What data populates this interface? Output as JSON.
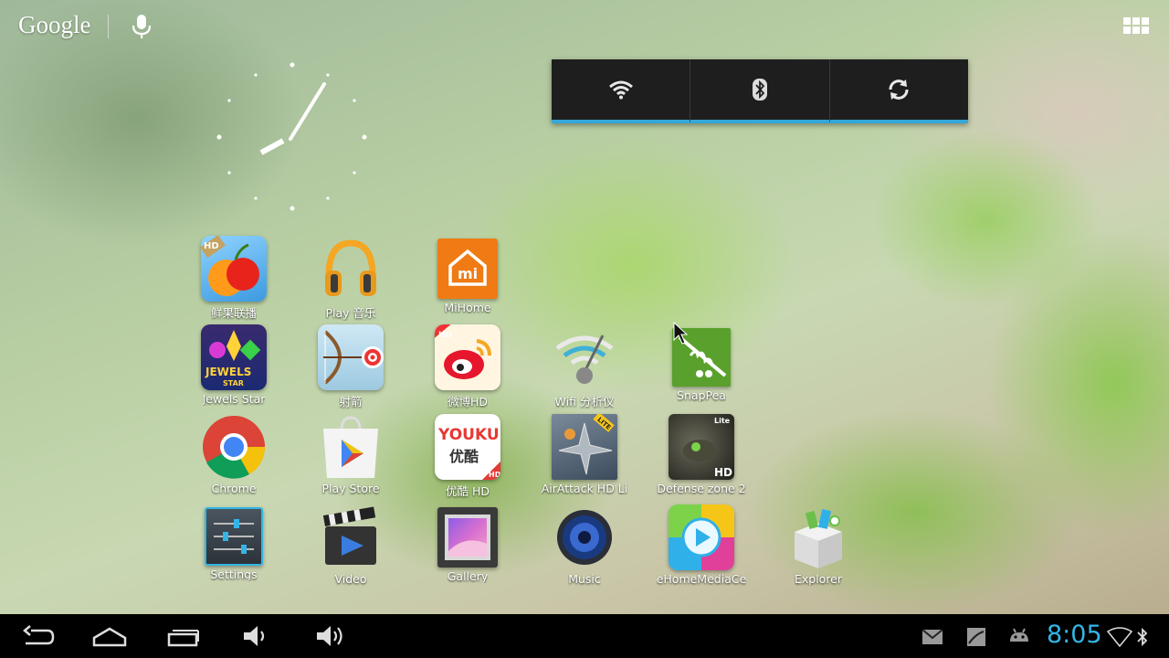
{
  "search_bar": {
    "brand": "Google",
    "voice_icon": "mic-icon"
  },
  "launcher_button_icon": "apps-grid-icon",
  "clock_widget": {
    "type": "analog",
    "time": "8:05"
  },
  "quick_settings": [
    {
      "name": "wifi",
      "icon": "wifi-icon"
    },
    {
      "name": "bluetooth",
      "icon": "bluetooth-icon"
    },
    {
      "name": "sync",
      "icon": "sync-icon"
    }
  ],
  "apps": {
    "xianguo": "鲜果联播",
    "play_music": "Play 音乐",
    "mihome": "MiHome",
    "jewels_star": "Jewels Star",
    "archery": "射箭",
    "weibo": "微博HD",
    "wifi_analyzer": "Wifi 分析仪",
    "snappea": "SnapPea",
    "chrome": "Chrome",
    "play_store": "Play Store",
    "youku": "优酷 HD",
    "airattack": "AirAttack HD Li",
    "defense_zone": "Defense zone 2",
    "settings": "Settings",
    "video": "Video",
    "gallery": "Gallery",
    "music": "Music",
    "ehome": "eHomeMediaCe",
    "explorer": "Explorer"
  },
  "icon_text": {
    "hd": "HD",
    "mi": "mi",
    "jewels": "JEWELS",
    "star": "STAR",
    "youku": "YOUKU",
    "youku_cn": "优酷",
    "lite_badge": "LITE",
    "lite": "Lite"
  },
  "status_bar": {
    "time": "8:05",
    "accent": "#33b5e5",
    "notifications": [
      "gmail-icon",
      "screenshot-icon",
      "android-debug-icon"
    ],
    "system_icons": [
      "wifi-signal-icon",
      "bluetooth-icon"
    ]
  },
  "nav_buttons": [
    "back-icon",
    "home-icon",
    "recents-icon",
    "volume-down-icon",
    "volume-up-icon"
  ]
}
